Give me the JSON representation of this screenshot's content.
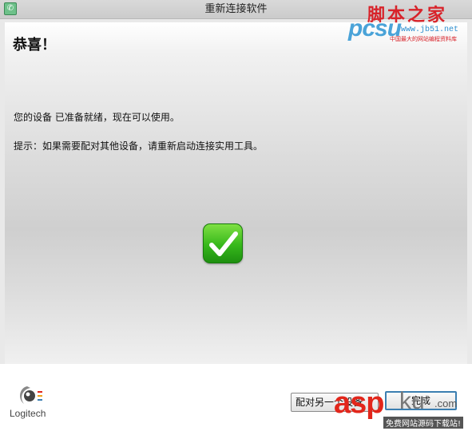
{
  "window": {
    "title": "重新连接软件"
  },
  "content": {
    "heading": "恭喜！",
    "message": "您的设备 已准备就绪，现在可以使用。",
    "hint": "提示：如果需要配对其他设备，请重新启动连接实用工具。",
    "status_icon": "checkmark-icon"
  },
  "footer": {
    "logo_text": "Logitech",
    "pair_button_label": "配对另一个设备",
    "finish_button_label": "完成"
  },
  "watermarks": {
    "top": {
      "domain_text": "pcsu",
      "site_name": "脚本之家",
      "url": "www.jb51.net",
      "tagline": "中国最大的网站编程资料库"
    },
    "bottom": {
      "asp_text": "asp",
      "ku_text": "ku",
      "com_text": ".com",
      "tagline": "免费网站源码下载站!"
    }
  },
  "colors": {
    "check_green": "#36b81b",
    "finish_border": "#3c7fb1",
    "watermark_red": "#d8232a"
  }
}
